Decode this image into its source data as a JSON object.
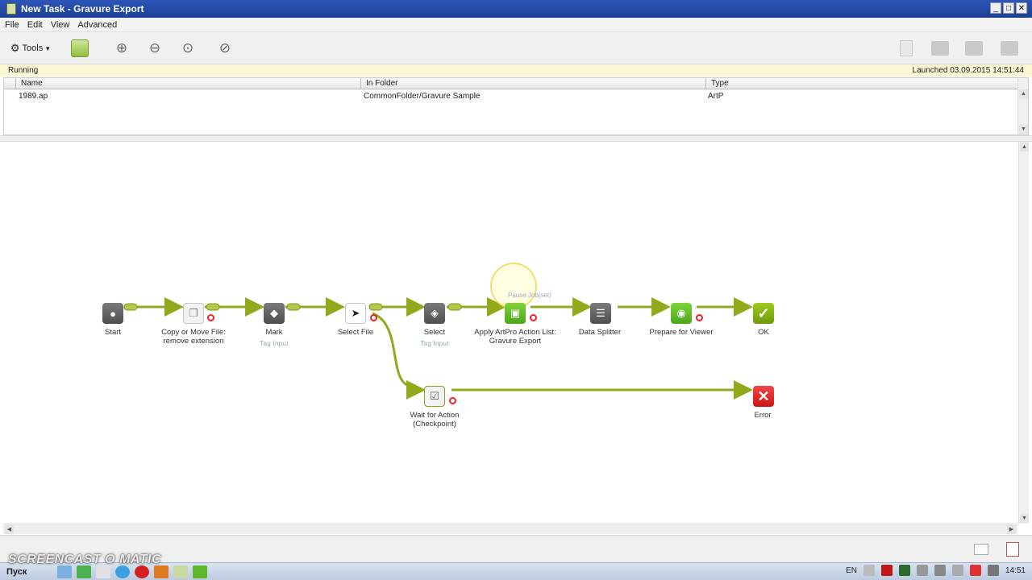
{
  "window": {
    "title": "New Task - Gravure Export",
    "buttons": [
      "_",
      "□",
      "✕"
    ]
  },
  "menu": [
    "File",
    "Edit",
    "View",
    "Advanced"
  ],
  "toolbar": {
    "tools_label": "Tools"
  },
  "status": {
    "state": "Running",
    "launched": "Launched 03.09.2015 14:51:44"
  },
  "table": {
    "columns": [
      "Name",
      "In Folder",
      "Type"
    ],
    "rows": [
      {
        "name": "1989.ap",
        "folder": "CommonFolder/Gravure Sample",
        "type": "ArtP"
      }
    ]
  },
  "flow": {
    "nodes": {
      "start": {
        "label": "Start"
      },
      "copy": {
        "label": "Copy or Move File: remove extension"
      },
      "mark": {
        "label": "Mark",
        "sub": "Tag Input"
      },
      "select_file": {
        "label": "Select File"
      },
      "select": {
        "label": "Select",
        "sub": "Tag Input"
      },
      "apply": {
        "label": "Apply ArtPro Action List: Gravure Export",
        "tag": "Pause Job(set)"
      },
      "splitter": {
        "label": "Data Splitter"
      },
      "prepare": {
        "label": "Prepare for Viewer"
      },
      "ok": {
        "label": "OK"
      },
      "wait": {
        "label": "Wait for Action (Checkpoint)"
      },
      "error": {
        "label": "Error"
      }
    }
  },
  "taskbar": {
    "start": "Пуск",
    "lang": "EN",
    "time": "14:51"
  },
  "watermark": "SCREENCAST O MATIC",
  "colors": {
    "connector": "#93a91c",
    "error": "#dd2222",
    "ok": "#7ea814",
    "titlebar": "#2146a6"
  }
}
